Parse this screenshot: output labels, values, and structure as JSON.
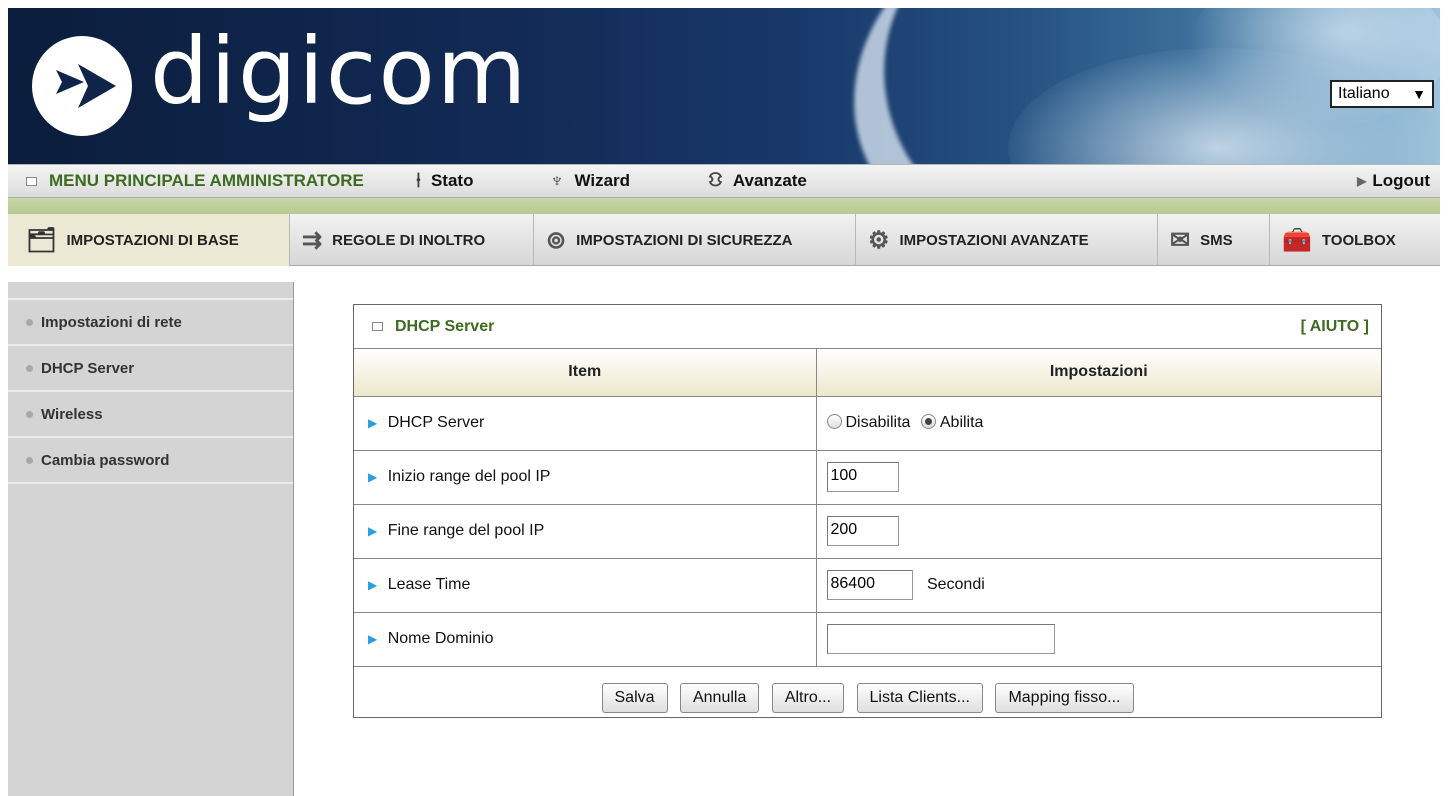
{
  "header": {
    "brand": "digicom",
    "language": "Italiano"
  },
  "admin_menu": {
    "title": "MENU PRINCIPALE AMMINISTRATORE",
    "items": [
      "Stato",
      "Wizard",
      "Avanzate"
    ],
    "logout": "Logout"
  },
  "tabs": [
    {
      "label": "IMPOSTAZIONI DI BASE",
      "icon": "folder-icon",
      "active": true
    },
    {
      "label": "REGOLE DI INOLTRO",
      "icon": "forward-arrows-icon",
      "active": false
    },
    {
      "label": "IMPOSTAZIONI DI SICUREZZA",
      "icon": "lock-ring-icon",
      "active": false
    },
    {
      "label": "IMPOSTAZIONI AVANZATE",
      "icon": "advanced-gear-icon",
      "active": false
    },
    {
      "label": "SMS",
      "icon": "envelope-icon",
      "active": false
    },
    {
      "label": "TOOLBOX",
      "icon": "toolbox-icon",
      "active": false
    }
  ],
  "sidebar": {
    "items": [
      "Impostazioni di rete",
      "DHCP Server",
      "Wireless",
      "Cambia password"
    ]
  },
  "panel": {
    "title": "DHCP Server",
    "help": "[ AIUTO ]",
    "col_item": "Item",
    "col_settings": "Impostazioni",
    "rows": {
      "dhcp_label": "DHCP Server",
      "disable": "Disabilita",
      "enable": "Abilita",
      "pool_start_label": "Inizio range del pool IP",
      "pool_start_value": "100",
      "pool_end_label": "Fine range del pool IP",
      "pool_end_value": "200",
      "lease_label": "Lease Time",
      "lease_value": "86400",
      "lease_unit": "Secondi",
      "domain_label": "Nome Dominio",
      "domain_value": ""
    },
    "buttons": {
      "save": "Salva",
      "cancel": "Annulla",
      "more": "Altro...",
      "clients": "Lista Clients...",
      "mapping": "Mapping fisso..."
    }
  },
  "colors": {
    "accent_green": "#3d6b1f",
    "arrow_blue": "#2aa0d8",
    "sidebar_gray": "#d4d4d4"
  }
}
